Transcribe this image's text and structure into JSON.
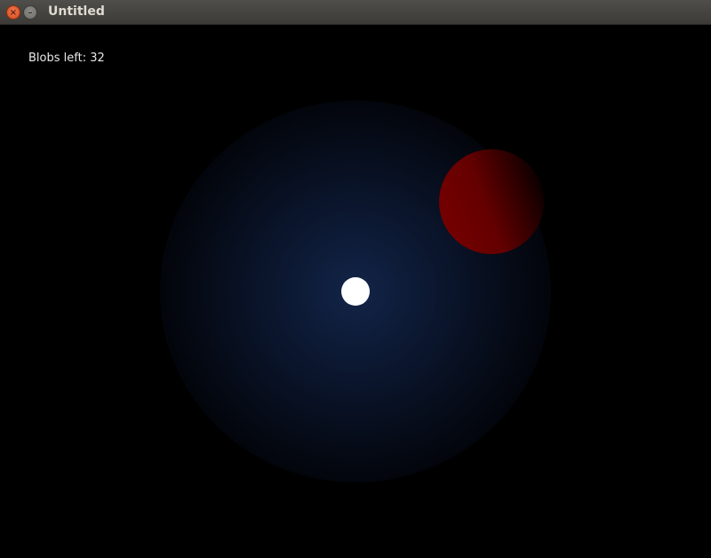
{
  "window": {
    "title": "Untitled",
    "close_glyph": "×",
    "minimize_glyph": "–"
  },
  "hud": {
    "blobs_left_text": "Blobs left: 32",
    "blobs_left_count": 32
  },
  "colors": {
    "background": "#000000",
    "player": "#ffffff",
    "enemy_blob": "#7a0000",
    "glow": "#122448",
    "hud_text": "#e8e8e8"
  }
}
